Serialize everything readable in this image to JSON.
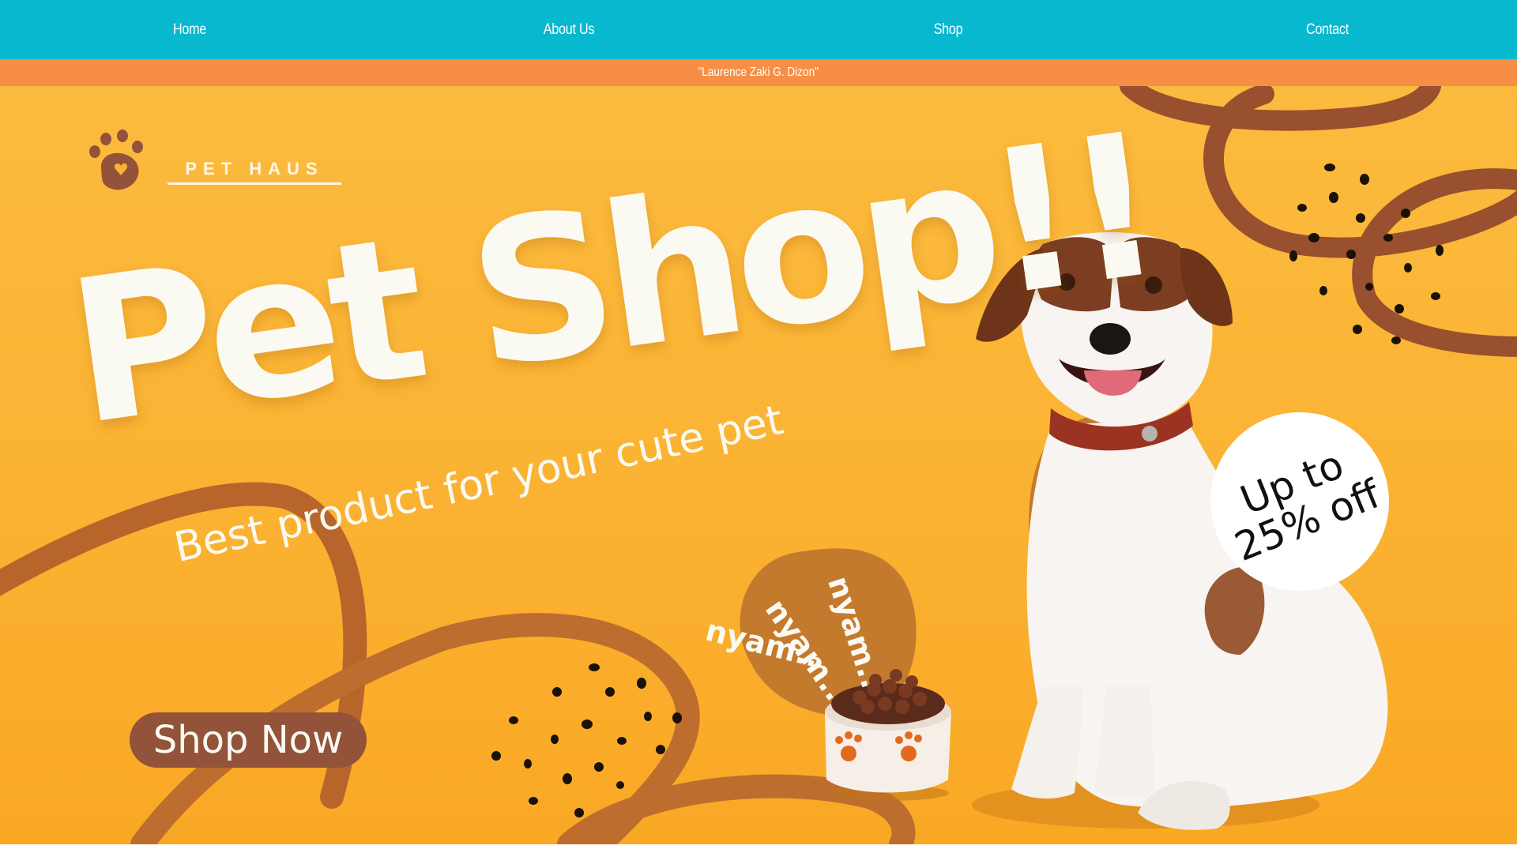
{
  "nav": {
    "items": [
      "Home",
      "About Us",
      "Shop",
      "Contact"
    ]
  },
  "credit_bar": {
    "text": "\"Laurence Zaki G. Dizon\""
  },
  "logo": {
    "icon": "paw-icon",
    "text": "PET HAUS"
  },
  "hero": {
    "title": "Pet Shop!!",
    "subtitle": "Best product for your cute pet",
    "shop_button": "Shop Now",
    "nyam": [
      "nyam..",
      "nyam..",
      "nyam.."
    ],
    "badge": {
      "line1": "Up to",
      "line2": "25% off"
    }
  },
  "colors": {
    "nav_bg": "#07b8cf",
    "credit_bar_bg": "#f78e45",
    "hero_bg": "#fbb232",
    "accent_brown": "#93523a",
    "text_cream": "#fbfaf2"
  }
}
